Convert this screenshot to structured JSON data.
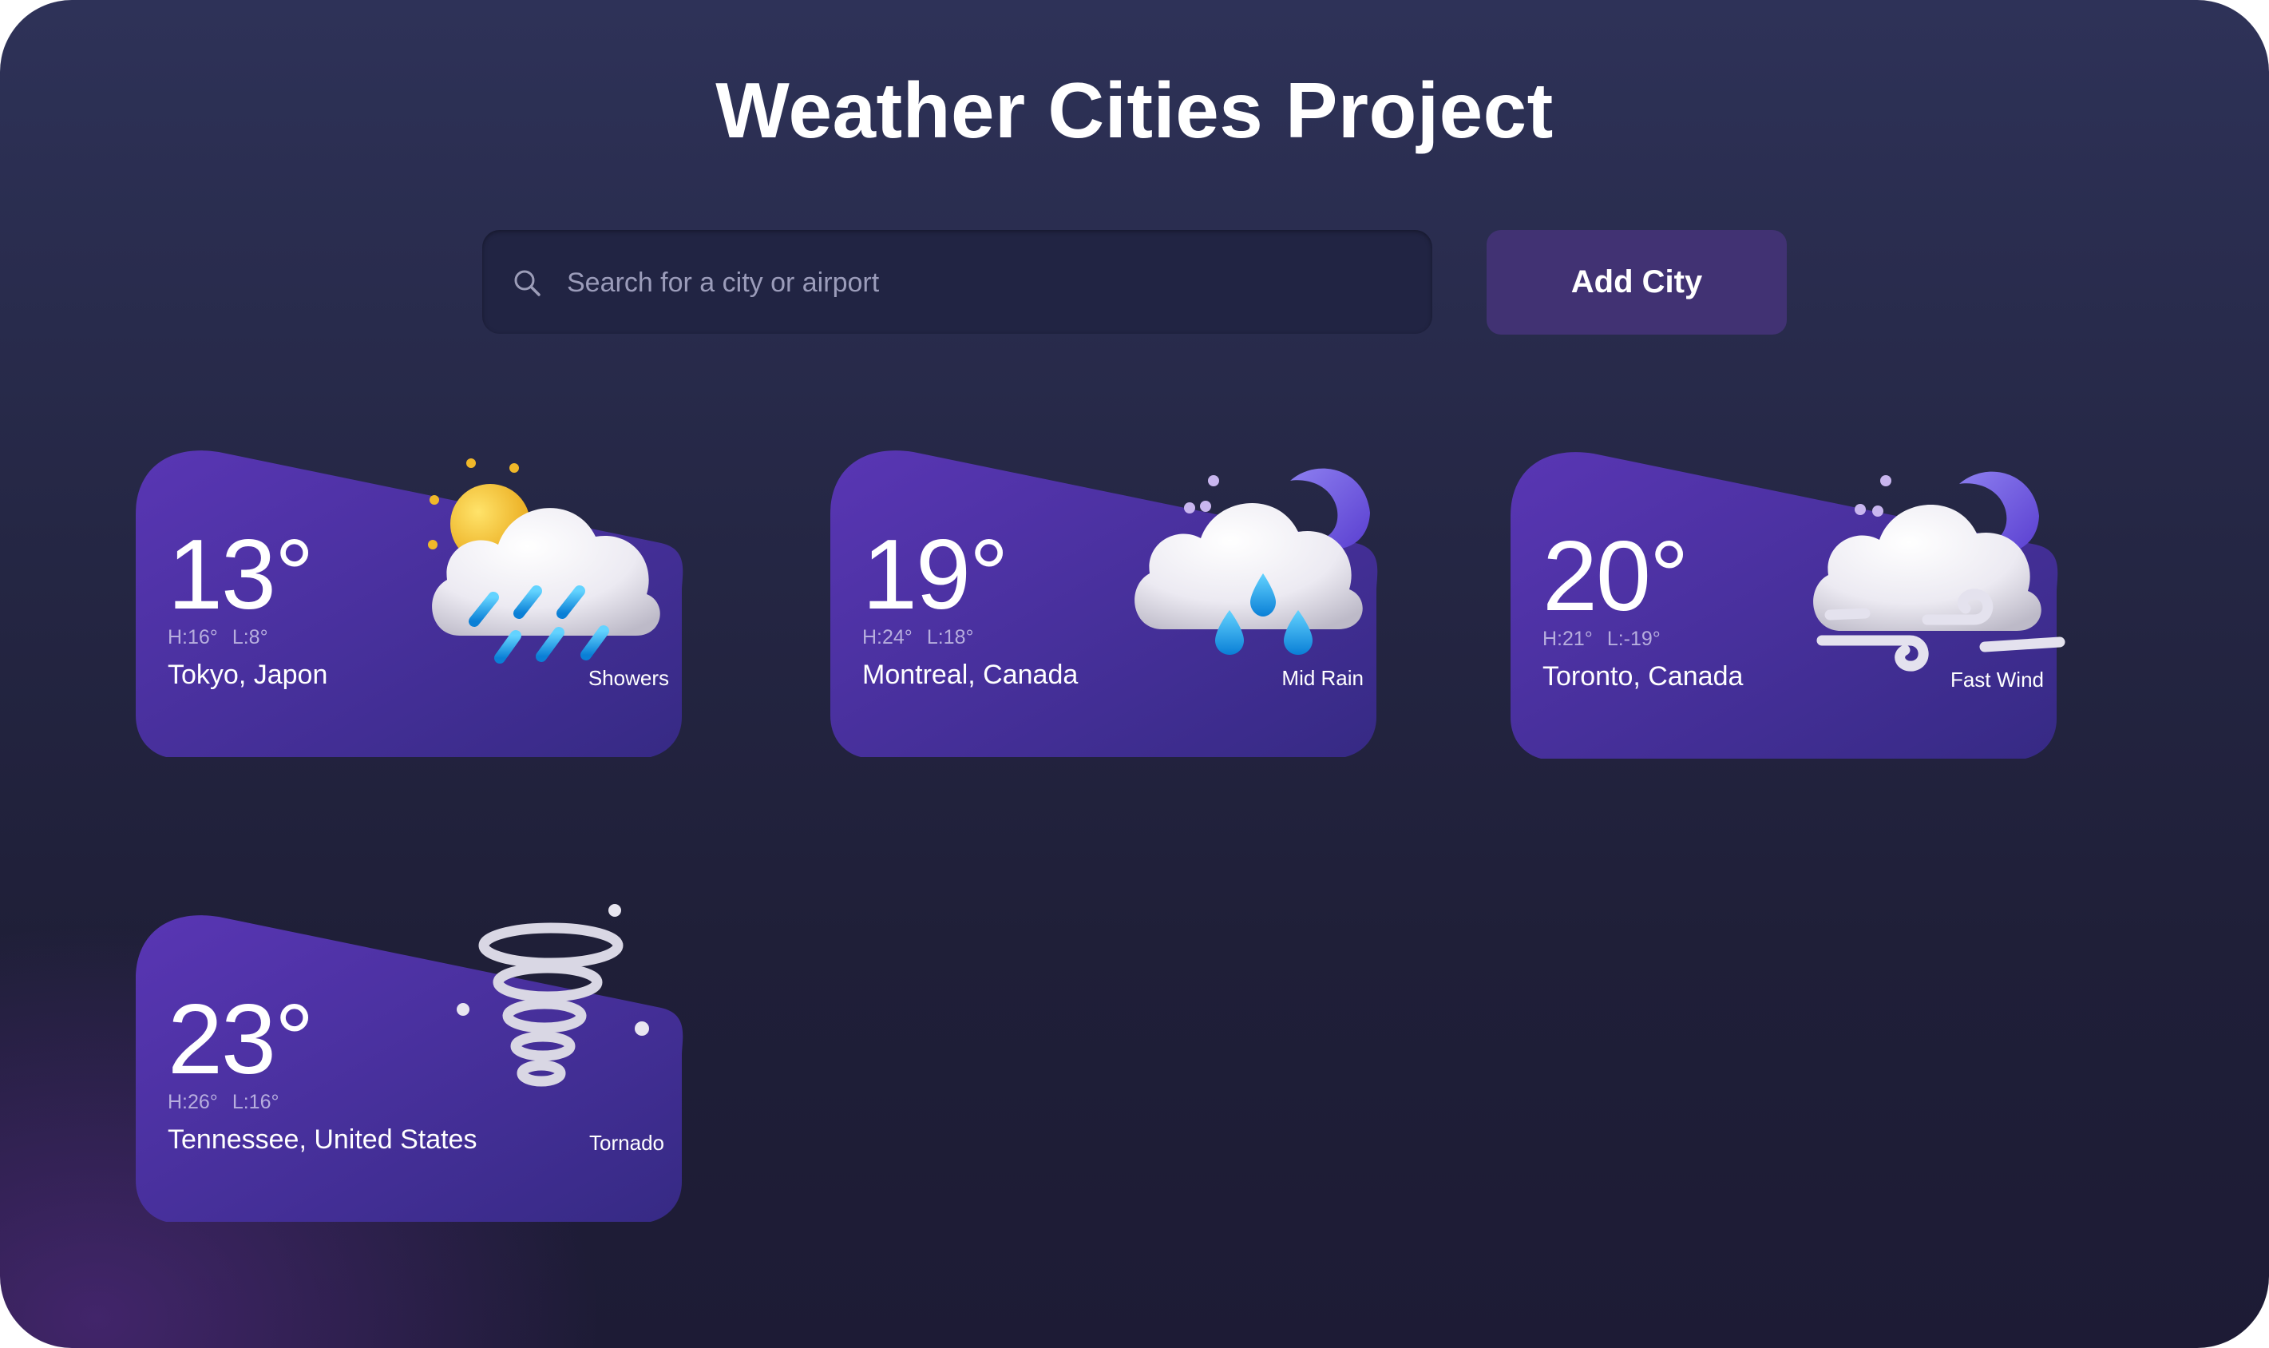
{
  "header": {
    "title": "Weather Cities Project"
  },
  "search": {
    "placeholder": "Search for a city or airport",
    "icon": "search-icon"
  },
  "actions": {
    "add_city_label": "Add City"
  },
  "colors": {
    "background_top": "#2e3258",
    "background_bottom": "#1d1b35",
    "card_gradient_start": "#5936b4",
    "card_gradient_end": "#362a84",
    "button": "#413273"
  },
  "cards": [
    {
      "temp": "13°",
      "high": "H:16°",
      "low": "L:8°",
      "city": "Tokyo, Japon",
      "condition": "Showers",
      "icon": "sun-cloud-rain-icon"
    },
    {
      "temp": "19°",
      "high": "H:24°",
      "low": "L:18°",
      "city": "Montreal, Canada",
      "condition": "Mid Rain",
      "icon": "moon-cloud-rain-icon"
    },
    {
      "temp": "20°",
      "high": "H:21°",
      "low": "L:-19°",
      "city": "Toronto, Canada",
      "condition": "Fast Wind",
      "icon": "moon-cloud-wind-icon"
    },
    {
      "temp": "23°",
      "high": "H:26°",
      "low": "L:16°",
      "city": "Tennessee, United States",
      "condition": "Tornado",
      "icon": "tornado-icon"
    }
  ]
}
